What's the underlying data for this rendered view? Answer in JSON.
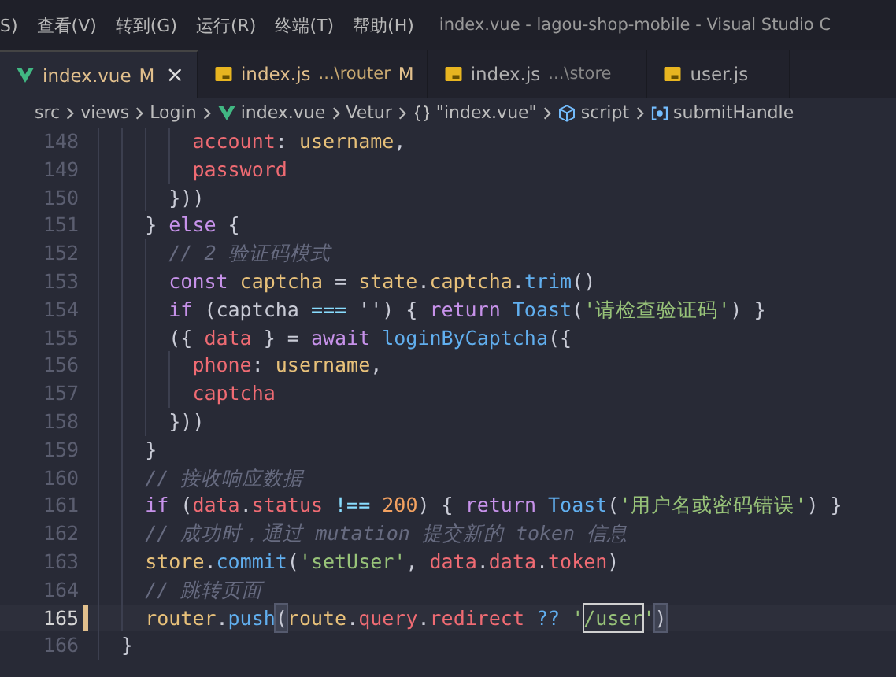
{
  "menu": {
    "items": [
      "S)",
      "查看(V)",
      "转到(G)",
      "运行(R)",
      "终端(T)",
      "帮助(H)"
    ],
    "title": "index.vue - lagou-shop-mobile - Visual Studio C"
  },
  "tabs": [
    {
      "kind": "vue",
      "name": "index.vue",
      "badge": "M",
      "modified": true,
      "selected": true,
      "close": "×"
    },
    {
      "kind": "js",
      "name": "index.js",
      "path": "...\\router",
      "badge": "M",
      "modified": true,
      "selected": false
    },
    {
      "kind": "js",
      "name": "index.js",
      "path": "...\\store",
      "modified": false,
      "selected": false
    },
    {
      "kind": "js",
      "name": "user.js",
      "modified": false,
      "selected": false
    }
  ],
  "breadcrumb": [
    {
      "label": "src",
      "kind": "plain"
    },
    {
      "label": "views",
      "kind": "plain"
    },
    {
      "label": "Login",
      "kind": "plain"
    },
    {
      "label": "index.vue",
      "kind": "vue"
    },
    {
      "label": "Vetur",
      "kind": "plain"
    },
    {
      "label": "\"index.vue\"",
      "kind": "braces"
    },
    {
      "label": "script",
      "kind": "cube"
    },
    {
      "label": "submitHandle",
      "kind": "method"
    }
  ],
  "lines": [
    {
      "number": "148",
      "active": false,
      "modified": false,
      "tokens": [
        {
          "text": "        account",
          "kind": "prop"
        },
        {
          "text": ": ",
          "kind": "punc"
        },
        {
          "text": "username",
          "kind": "var"
        },
        {
          "text": ",",
          "kind": "punc"
        }
      ]
    },
    {
      "number": "149",
      "active": false,
      "modified": false,
      "tokens": [
        {
          "text": "        password",
          "kind": "prop"
        }
      ]
    },
    {
      "number": "150",
      "active": false,
      "modified": false,
      "tokens": [
        {
          "text": "      }))",
          "kind": "punc"
        }
      ]
    },
    {
      "number": "151",
      "active": false,
      "modified": false,
      "tokens": [
        {
          "text": "    } ",
          "kind": "punc"
        },
        {
          "text": "else",
          "kind": "kw"
        },
        {
          "text": " {",
          "kind": "punc"
        }
      ]
    },
    {
      "number": "152",
      "active": false,
      "modified": false,
      "tokens": [
        {
          "text": "      // 2 验证码模式",
          "kind": "com"
        }
      ]
    },
    {
      "number": "153",
      "active": false,
      "modified": false,
      "tokens": [
        {
          "text": "      const ",
          "kind": "kw"
        },
        {
          "text": "captcha",
          "kind": "var"
        },
        {
          "text": " = ",
          "kind": "punc"
        },
        {
          "text": "state",
          "kind": "var"
        },
        {
          "text": ".",
          "kind": "punc"
        },
        {
          "text": "captcha",
          "kind": "var"
        },
        {
          "text": ".",
          "kind": "punc"
        },
        {
          "text": "trim",
          "kind": "fn"
        },
        {
          "text": "()",
          "kind": "punc"
        }
      ]
    },
    {
      "number": "154",
      "active": false,
      "modified": false,
      "tokens": [
        {
          "text": "      if ",
          "kind": "kw"
        },
        {
          "text": "(captcha ",
          "kind": "punc"
        },
        {
          "text": "===",
          "kind": "op"
        },
        {
          "text": " '') { ",
          "kind": "punc"
        },
        {
          "text": "return ",
          "kind": "kw"
        },
        {
          "text": "Toast",
          "kind": "fn"
        },
        {
          "text": "(",
          "kind": "punc"
        },
        {
          "text": "'请检查验证码'",
          "kind": "str"
        },
        {
          "text": ") }",
          "kind": "punc"
        }
      ]
    },
    {
      "number": "155",
      "active": false,
      "modified": false,
      "tokens": [
        {
          "text": "      ({ ",
          "kind": "punc"
        },
        {
          "text": "data",
          "kind": "prop"
        },
        {
          "text": " } = ",
          "kind": "punc"
        },
        {
          "text": "await ",
          "kind": "kw"
        },
        {
          "text": "loginByCaptcha",
          "kind": "fn"
        },
        {
          "text": "({",
          "kind": "punc"
        }
      ]
    },
    {
      "number": "156",
      "active": false,
      "modified": false,
      "tokens": [
        {
          "text": "        phone",
          "kind": "prop"
        },
        {
          "text": ": ",
          "kind": "punc"
        },
        {
          "text": "username",
          "kind": "var"
        },
        {
          "text": ",",
          "kind": "punc"
        }
      ]
    },
    {
      "number": "157",
      "active": false,
      "modified": false,
      "tokens": [
        {
          "text": "        captcha",
          "kind": "prop"
        }
      ]
    },
    {
      "number": "158",
      "active": false,
      "modified": false,
      "tokens": [
        {
          "text": "      }))",
          "kind": "punc"
        }
      ]
    },
    {
      "number": "159",
      "active": false,
      "modified": false,
      "tokens": [
        {
          "text": "    }",
          "kind": "punc"
        }
      ]
    },
    {
      "number": "160",
      "active": false,
      "modified": false,
      "tokens": [
        {
          "text": "    // 接收响应数据",
          "kind": "com"
        }
      ]
    },
    {
      "number": "161",
      "active": false,
      "modified": false,
      "tokens": [
        {
          "text": "    if ",
          "kind": "kw"
        },
        {
          "text": "(",
          "kind": "punc"
        },
        {
          "text": "data",
          "kind": "prop"
        },
        {
          "text": ".",
          "kind": "punc"
        },
        {
          "text": "status",
          "kind": "prop"
        },
        {
          "text": " !== ",
          "kind": "op"
        },
        {
          "text": "200",
          "kind": "num"
        },
        {
          "text": ") { ",
          "kind": "punc"
        },
        {
          "text": "return ",
          "kind": "kw"
        },
        {
          "text": "Toast",
          "kind": "fn"
        },
        {
          "text": "(",
          "kind": "punc"
        },
        {
          "text": "'用户名或密码错误'",
          "kind": "str"
        },
        {
          "text": ") }",
          "kind": "punc"
        }
      ]
    },
    {
      "number": "162",
      "active": false,
      "modified": false,
      "tokens": [
        {
          "text": "    // 成功时，通过 mutation 提交新的 token 信息",
          "kind": "com"
        }
      ]
    },
    {
      "number": "163",
      "active": false,
      "modified": false,
      "tokens": [
        {
          "text": "    store",
          "kind": "var"
        },
        {
          "text": ".",
          "kind": "punc"
        },
        {
          "text": "commit",
          "kind": "fn"
        },
        {
          "text": "(",
          "kind": "punc"
        },
        {
          "text": "'setUser'",
          "kind": "str"
        },
        {
          "text": ", ",
          "kind": "punc"
        },
        {
          "text": "data",
          "kind": "prop"
        },
        {
          "text": ".",
          "kind": "punc"
        },
        {
          "text": "data",
          "kind": "prop"
        },
        {
          "text": ".",
          "kind": "punc"
        },
        {
          "text": "token",
          "kind": "prop"
        },
        {
          "text": ")",
          "kind": "punc"
        }
      ]
    },
    {
      "number": "164",
      "active": false,
      "modified": false,
      "tokens": [
        {
          "text": "    // 跳转页面",
          "kind": "com"
        }
      ]
    },
    {
      "number": "165",
      "active": true,
      "modified": true,
      "tokens": [
        {
          "text": "    router",
          "kind": "var"
        },
        {
          "text": ".",
          "kind": "punc"
        },
        {
          "text": "push",
          "kind": "fn"
        },
        {
          "text": "(",
          "kind": "match"
        },
        {
          "text": "route",
          "kind": "var"
        },
        {
          "text": ".",
          "kind": "punc"
        },
        {
          "text": "query",
          "kind": "prop"
        },
        {
          "text": ".",
          "kind": "punc"
        },
        {
          "text": "redirect",
          "kind": "prop"
        },
        {
          "text": " ?? ",
          "kind": "op2"
        },
        {
          "text": "'",
          "kind": "str"
        },
        {
          "text": "/user",
          "kind": "sel"
        },
        {
          "text": "'",
          "kind": "str"
        },
        {
          "text": ")",
          "kind": "match"
        }
      ]
    },
    {
      "number": "166",
      "active": false,
      "modified": false,
      "tokens": [
        {
          "text": "  }",
          "kind": "punc"
        }
      ]
    }
  ]
}
